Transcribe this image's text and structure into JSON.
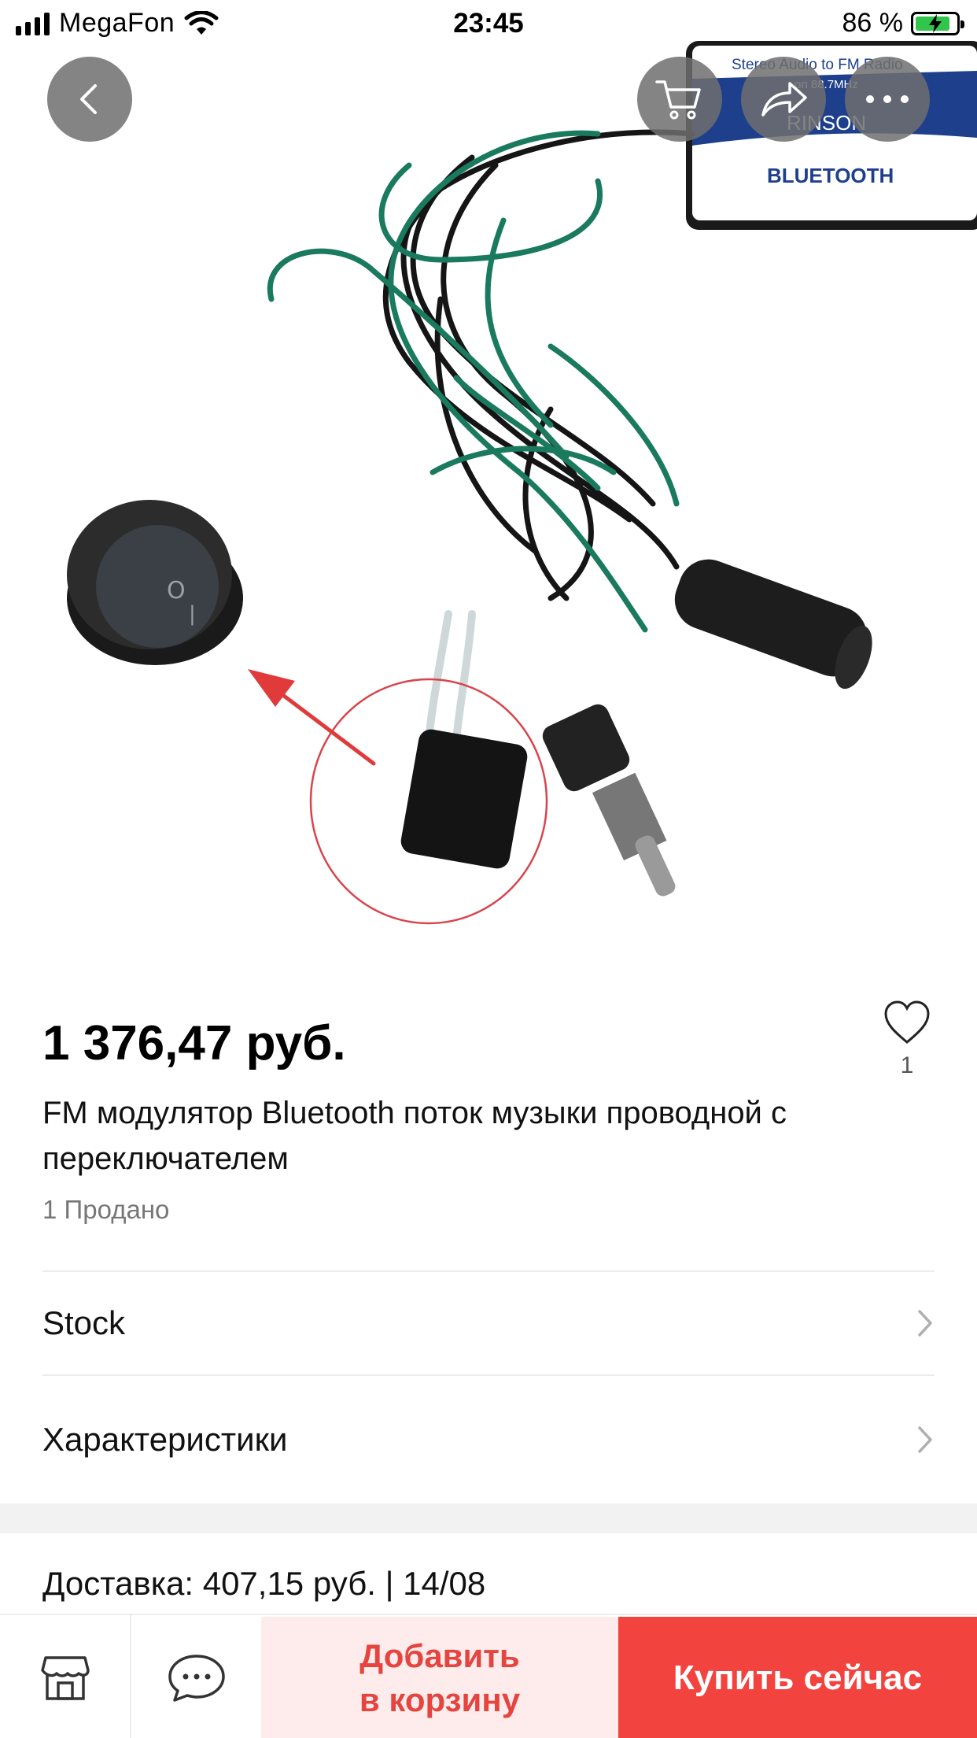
{
  "status_bar": {
    "carrier": "MegaFon",
    "time": "23:45",
    "battery_percent": "86 %",
    "battery_level": 0.86
  },
  "gallery": {
    "icons": {
      "back": "chevron-left-icon",
      "cart": "cart-icon",
      "share": "share-icon",
      "more": "more-dots-icon"
    },
    "product_box_text": {
      "line1": "Stereo Audio to FM Radio",
      "line2": "on 88.7MHz",
      "brand": "RINSON",
      "label": "BLUETOOTH"
    }
  },
  "product": {
    "price": "1 376,47 руб.",
    "favorites_count": "1",
    "title": "FM модулятор Bluetooth поток музыки проводной с переключателем",
    "sold": "1 Продано"
  },
  "rows": [
    {
      "label": "Stock"
    },
    {
      "label": "Характеристики"
    }
  ],
  "delivery": {
    "text": "Доставка: 407,15 руб. | 14/08"
  },
  "bottom_bar": {
    "store_icon": "store-icon",
    "chat_icon": "chat-icon",
    "add_to_cart_line1": "Добавить",
    "add_to_cart_line2": "в корзину",
    "buy_now": "Купить сейчас"
  },
  "colors": {
    "accent": "#f3433f",
    "accent_light": "#fdeceb",
    "accent_text": "#e5443f",
    "battery_green": "#31c54c"
  }
}
